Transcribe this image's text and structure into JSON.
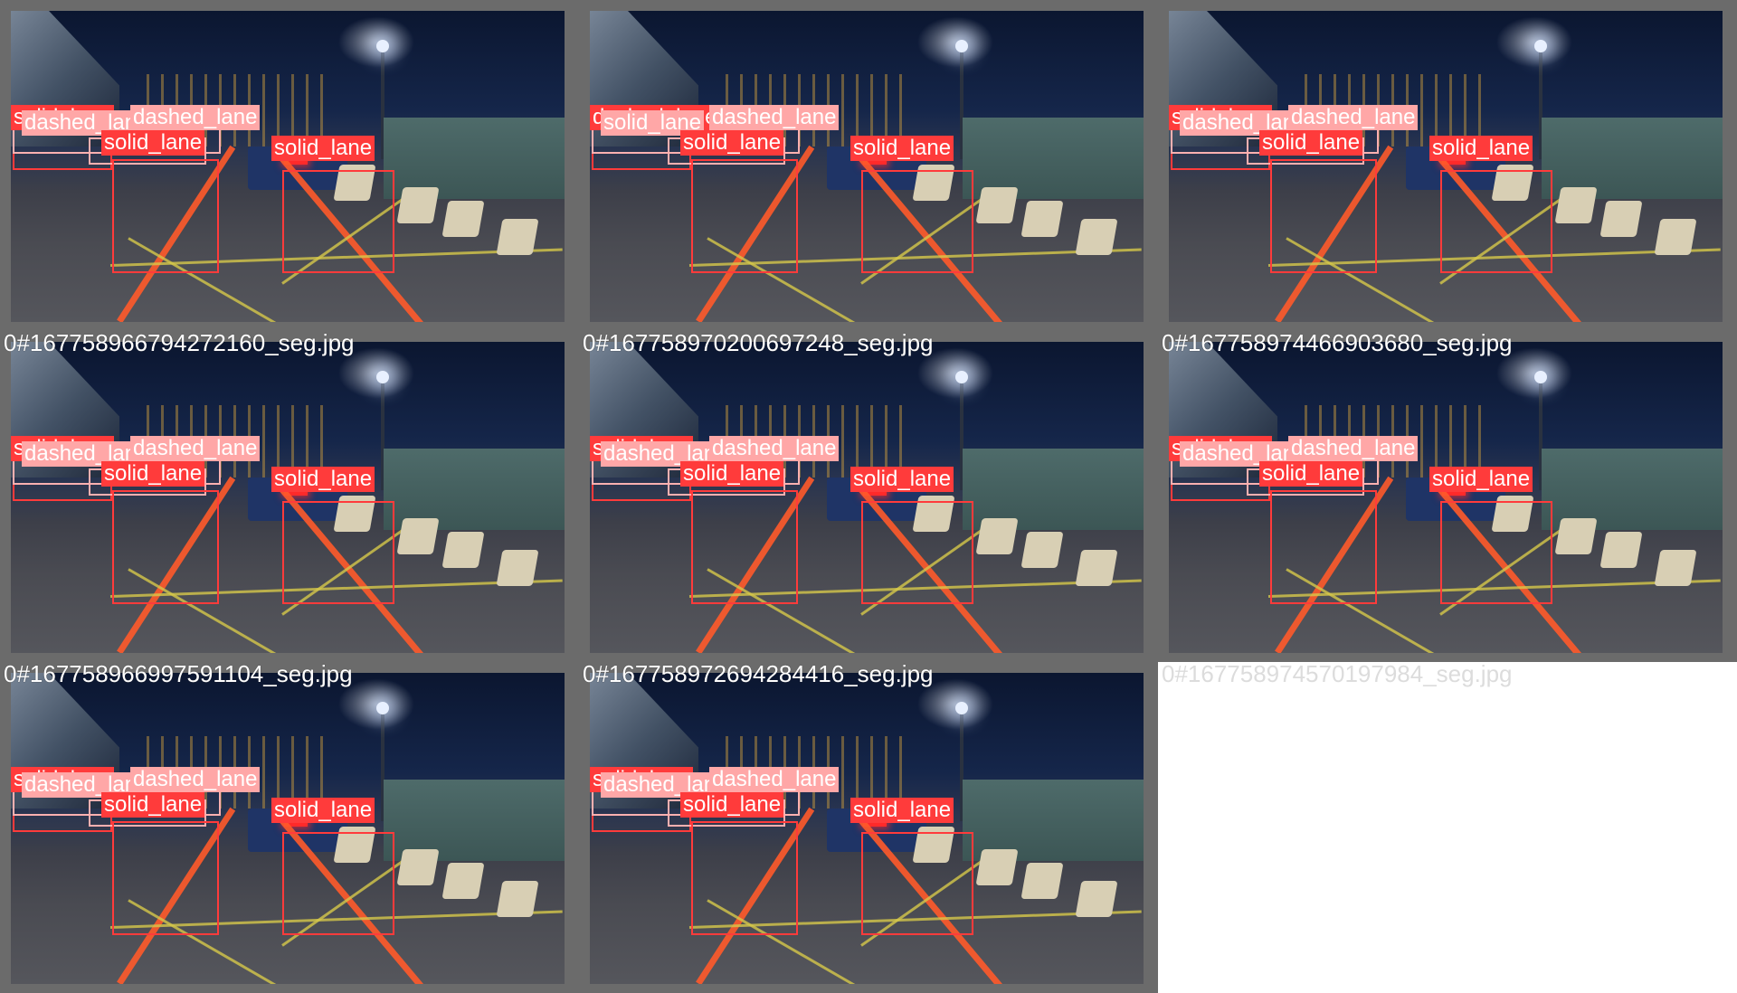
{
  "tiles": [
    {
      "caption": "",
      "labels": {
        "a": "solid_lane",
        "b": "dashed_lane",
        "c": "dashed_lane",
        "d": "solid_lane",
        "e": "solid_lane"
      }
    },
    {
      "caption": "",
      "labels": {
        "a": "dashed_lane",
        "b": "solid_lane",
        "c": "dashed_lane",
        "d": "solid_lane",
        "e": "solid_lane"
      }
    },
    {
      "caption": "",
      "labels": {
        "a": "solid_lane",
        "b": "dashed_lane",
        "c": "dashed_lane",
        "d": "solid_lane",
        "e": "solid_lane"
      }
    },
    {
      "caption": "0#1677589667942 72160_seg.jpg",
      "labels": {
        "a": "solid_lane",
        "b": "dashed_lane",
        "c": "dashed_lane",
        "d": "solid_lane",
        "e": "solid_lane"
      }
    },
    {
      "caption": "0#1677589702006 97248_seg.jpg",
      "labels": {
        "a": "solid_lane",
        "b": "dashed_lane",
        "c": "dashed_lane",
        "d": "solid_lane",
        "e": "solid_lane"
      }
    },
    {
      "caption": "0#1677589744669 03680_seg.jpg",
      "labels": {
        "a": "solid_lane",
        "b": "dashed_lane",
        "c": "dashed_lane",
        "d": "solid_lane",
        "e": "solid_lane"
      }
    },
    {
      "caption": "0#1677589669975 91104_seg.jpg",
      "labels": {
        "a": "solid_lane",
        "b": "dashed_lane",
        "c": "dashed_lane",
        "d": "solid_lane",
        "e": "solid_lane"
      }
    },
    {
      "caption": "0#1677589726942 84416_seg.jpg",
      "labels": {
        "a": "solid_lane",
        "b": "dashed_lane",
        "c": "dashed_lane",
        "d": "solid_lane",
        "e": "solid_lane"
      }
    },
    {
      "caption": "0#1677589745701 97984_seg.jpg",
      "empty": true
    }
  ]
}
